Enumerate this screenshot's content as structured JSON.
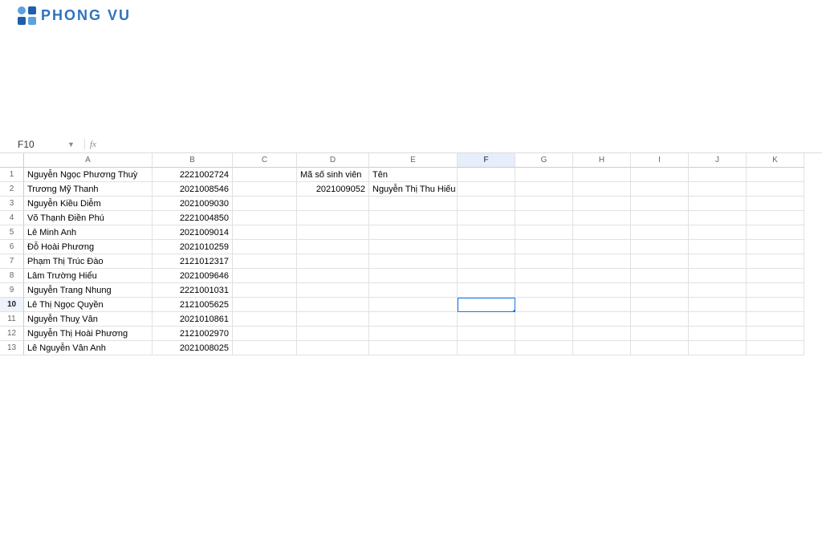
{
  "brand": {
    "text": "PHONG VU"
  },
  "namebox": {
    "value": "F10",
    "fx": "fx"
  },
  "columns": [
    "A",
    "B",
    "C",
    "D",
    "E",
    "F",
    "G",
    "H",
    "I",
    "J",
    "K"
  ],
  "activeCol": "F",
  "activeRow": 10,
  "selectedCell": "F10",
  "header_d1": "Mã số sinh viên",
  "header_e1": "Tên",
  "lookup_d2": "2021009052",
  "lookup_e2": "Nguyễn Thị Thu Hiếu",
  "rows": [
    {
      "n": "1",
      "a": "Nguyễn Ngọc Phương Thuỳ",
      "b": "2221002724"
    },
    {
      "n": "2",
      "a": "Trương Mỹ Thanh",
      "b": "2021008546"
    },
    {
      "n": "3",
      "a": "Nguyễn Kiều Diễm",
      "b": "2021009030"
    },
    {
      "n": "4",
      "a": "Võ Thạnh Điền Phú",
      "b": "2221004850"
    },
    {
      "n": "5",
      "a": "Lê Minh Anh",
      "b": "2021009014"
    },
    {
      "n": "6",
      "a": "Đỗ Hoài Phương",
      "b": "2021010259"
    },
    {
      "n": "7",
      "a": "Phạm Thị Trúc Đào",
      "b": "2121012317"
    },
    {
      "n": "8",
      "a": "Lâm Trường Hiểu",
      "b": "2021009646"
    },
    {
      "n": "9",
      "a": "Nguyễn Trang Nhung",
      "b": "2221001031"
    },
    {
      "n": "10",
      "a": "Lê Thị Ngọc Quyền",
      "b": "2121005625"
    },
    {
      "n": "11",
      "a": "Nguyễn Thuỵ Vân",
      "b": "2021010861"
    },
    {
      "n": "12",
      "a": "Nguyễn Thị Hoài Phương",
      "b": "2121002970"
    },
    {
      "n": "13",
      "a": "Lê Nguyễn Vân Anh",
      "b": "2021008025"
    }
  ]
}
